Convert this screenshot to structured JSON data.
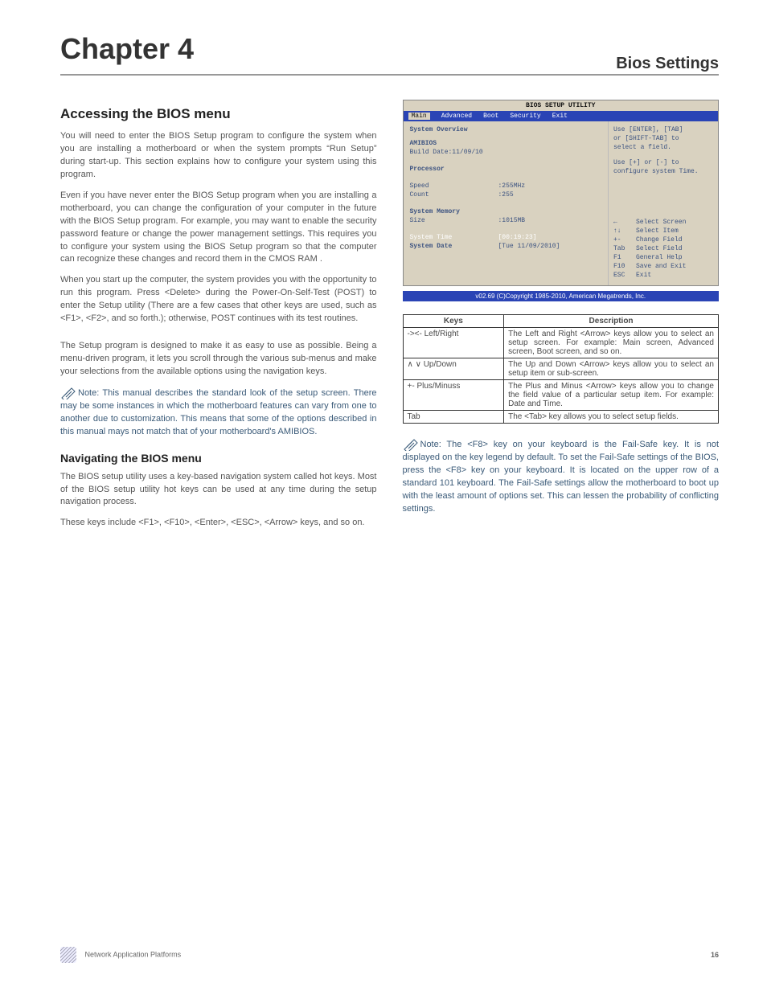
{
  "header": {
    "chapter": "Chapter 4",
    "topright": "Bios Settings"
  },
  "left": {
    "h_accessing": "Accessing the BIOS menu",
    "p1": "You will need to enter the BIOS Setup program to configure the system when you are installing a motherboard or when the system prompts “Run Setup” during start-up. This section explains how to configure your system using this program.",
    "p2": "Even if you have never enter the BIOS Setup program when you are installing a motherboard, you can change the configuration of your computer in the future with the BIOS Setup program. For example, you may want to enable the security password feature or change the power management settings. This requires you to configure your system using the BIOS Setup program so that the computer can recognize these changes and record them in the CMOS RAM .",
    "p3": "When you start up the computer, the system provides you with the opportunity to run this program. Press <Delete> during the Power-On-Self-Test (POST) to enter the Setup utility (There are a few cases that other keys are used, such as <F1>, <F2>, and so forth.); otherwise, POST continues with its test routines.",
    "p4": "The Setup program is designed to make it as easy to use as possible. Being a menu-driven program, it lets you scroll through the various sub-menus and make your selections from the available options using the navigation keys.",
    "note1": "Note:  This manual describes the standard look of the setup screen. There may be some instances in which the  motherboard features can vary from one to another due to customization. This means that some of the options described in this manual mays not match that of your motherboard's AMIBIOS.",
    "h_nav": "Navigating the BIOS menu",
    "p5": "The BIOS setup utility uses a key-based navigation system called hot keys. Most of the BIOS setup utility hot keys can be used at any time during the setup navigation process.",
    "p6": "These keys include <F1>, <F10>, <Enter>, <ESC>, <Arrow> keys, and so on."
  },
  "bios": {
    "title": "BIOS SETUP UTILITY",
    "tabs": [
      "Main",
      "Advanced",
      "Boot",
      "Security",
      "Exit"
    ],
    "overview": "System Overview",
    "amibios": "AMIBIOS",
    "build": "Build Date:11/09/10",
    "processor": "Processor",
    "speed_label": "Speed",
    "speed_val": ":255MHz",
    "count_label": "Count",
    "count_val": ":255",
    "sysmem": "System Memory",
    "size_label": "Size",
    "size_val": ":1015MB",
    "systime": "System Time",
    "systime_val": "[00:19:23]",
    "sysdate": "System Date",
    "sysdate_val": "[Tue 11/09/2010]",
    "help1": "Use [ENTER], [TAB]",
    "help2": "or [SHIFT-TAB] to",
    "help3": "select a field.",
    "help4": "Use [+] or [-] to",
    "help5": "configure system Time.",
    "nav": [
      {
        "k": "←",
        "v": "Select Screen"
      },
      {
        "k": "↑↓",
        "v": "Select Item"
      },
      {
        "k": "+-",
        "v": "Change Field"
      },
      {
        "k": "Tab",
        "v": "Select Field"
      },
      {
        "k": "F1",
        "v": "General Help"
      },
      {
        "k": "F10",
        "v": "Save and Exit"
      },
      {
        "k": "ESC",
        "v": "Exit"
      }
    ],
    "footer": "v02.69 (C)Copyright 1985-2010, American Megatrends, Inc."
  },
  "table": {
    "h1": "Keys",
    "h2": "Description",
    "rows": [
      {
        "k": "-><- Left/Right",
        "d": "The Left and Right <Arrow> keys allow you to select an setup screen. For example: Main screen, Advanced screen, Boot screen, and so on."
      },
      {
        "k": "∧ ∨ Up/Down",
        "d": "The Up and Down <Arrow> keys allow you to select an setup item or sub-screen."
      },
      {
        "k": "+- Plus/Minuss",
        "d": "The Plus and Minus <Arrow> keys allow you to change the field value of a particular setup item. For example: Date and Time."
      },
      {
        "k": "Tab",
        "d": "The <Tab> key allows you to select setup fields."
      }
    ]
  },
  "note2": "Note:  The <F8> key on your keyboard is the Fail-Safe key. It is not displayed on the key legend by default. To set the Fail-Safe settings of the BIOS, press the <F8> key on your keyboard. It is located on the upper row of a standard 101 keyboard. The Fail-Safe settings allow the motherboard to boot up with the least amount of options set. This can lessen the probability of conflicting settings.",
  "footer": {
    "text": "Network Application Platforms",
    "pagenum": "16"
  }
}
